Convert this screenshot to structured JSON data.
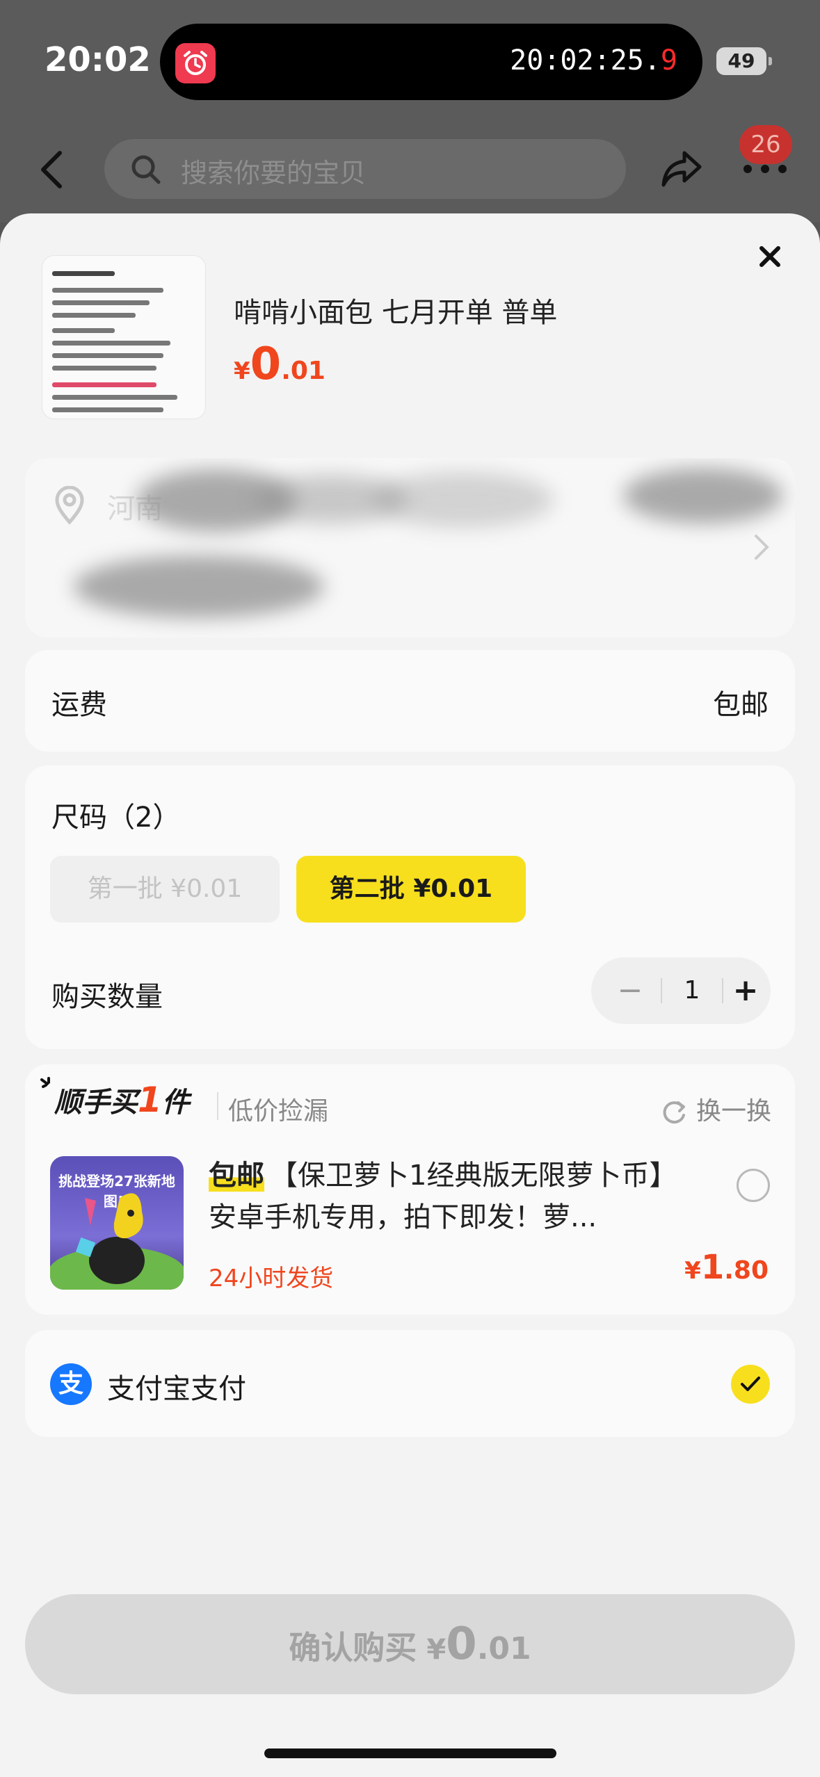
{
  "status_bar": {
    "time": "20:02",
    "timer_main": "20:02:25.",
    "timer_tenth": "9",
    "battery": "49"
  },
  "background": {
    "search_placeholder": "搜索你要的宝贝",
    "cart_badge": "26"
  },
  "product": {
    "title": "啃啃小面包 七月开单 普单",
    "price_symbol": "¥",
    "price_int": "0",
    "price_dec": ".01"
  },
  "address": {
    "visible_text": "河南"
  },
  "shipping": {
    "label": "运费",
    "value": "包邮"
  },
  "size": {
    "label": "尺码（2）",
    "options": [
      {
        "label": "第一批   ¥0.01",
        "selected": false,
        "disabled": true
      },
      {
        "label": "第二批   ¥0.01",
        "selected": true
      }
    ]
  },
  "quantity": {
    "label": "购买数量",
    "value": "1",
    "minus": "−",
    "plus": "+"
  },
  "addon": {
    "title_pre": "顺手买",
    "title_num": "1",
    "title_post": "件",
    "subtitle": "低价捡漏",
    "refresh_label": "换一换",
    "image_banner": "挑战登场27张新地图!!",
    "tag": "包邮",
    "description": "【保卫萝卜1经典版无限萝卜币】安卓手机专用，拍下即发！萝...",
    "ship_note": "24小时发货",
    "price_symbol": "¥",
    "price_int": "1",
    "price_dec": ".80"
  },
  "payment": {
    "label": "支付宝支付",
    "icon_glyph": "支",
    "selected": true
  },
  "confirm": {
    "label": "确认购买",
    "price_symbol": "¥",
    "price_int": "0",
    "price_dec": ".01"
  },
  "colors": {
    "accent_yellow": "#f7df1e",
    "price_red": "#f0461e",
    "alipay_blue": "#1677ff"
  }
}
